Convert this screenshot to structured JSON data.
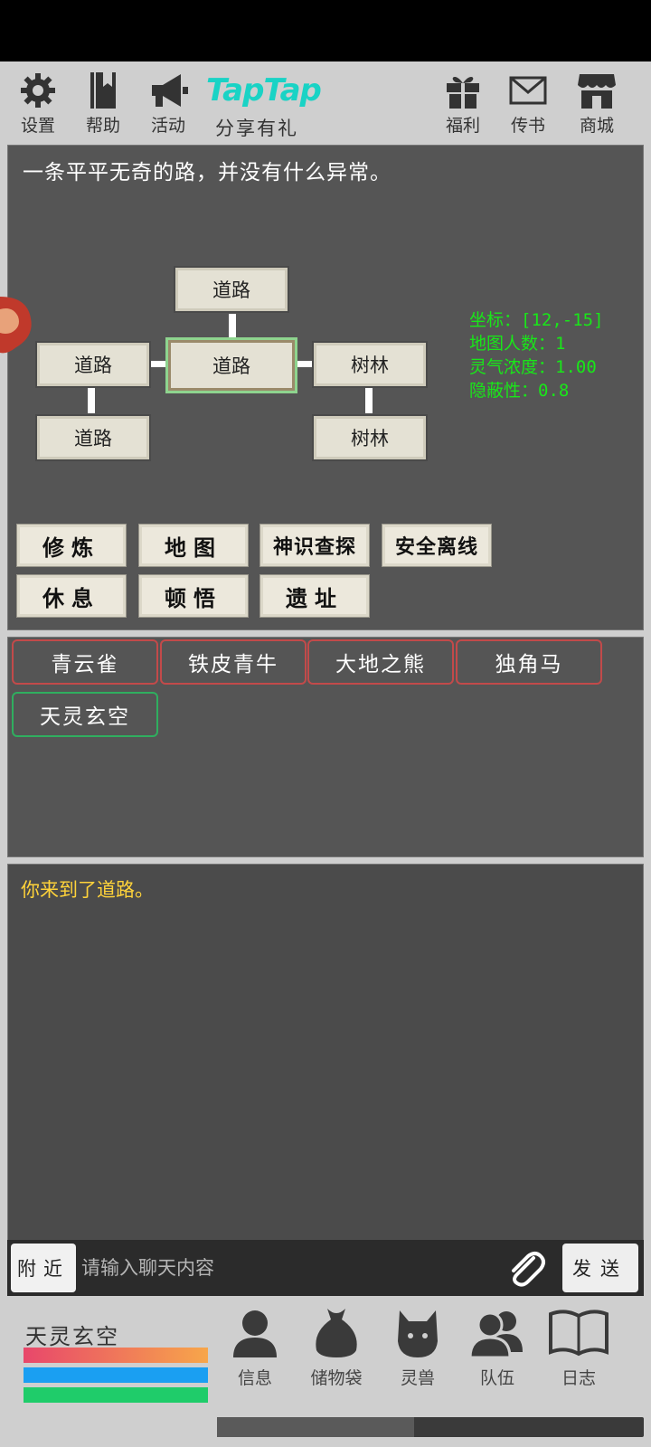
{
  "toolbar": {
    "settings_label": "设置",
    "help_label": "帮助",
    "activity_label": "活动",
    "taptap_logo": "TapTap",
    "share_label": "分享有礼",
    "welfare_label": "福利",
    "mail_label": "传书",
    "shop_label": "商城"
  },
  "map": {
    "description": "一条平平无奇的路，并没有什么异常。",
    "rooms": {
      "north": "道路",
      "west": "道路",
      "center": "道路",
      "east": "树林",
      "southwest": "道路",
      "southeast": "树林"
    },
    "stats": {
      "coords": "坐标：[12,-15]",
      "population": "地图人数：1",
      "spirit": "灵气浓度：1.00",
      "stealth": "隐蔽性：0.8"
    }
  },
  "actions": {
    "cultivate": "修炼",
    "map": "地图",
    "divine_sense": "神识查探",
    "safe_logout": "安全离线",
    "rest": "休息",
    "enlighten": "顿悟",
    "ruins": "遗址"
  },
  "beasts": [
    "青云雀",
    "铁皮青牛",
    "大地之熊",
    "独角马",
    "天灵玄空"
  ],
  "log": {
    "line1": "你来到了道路。"
  },
  "chat": {
    "channel_label": "附近",
    "placeholder": "请输入聊天内容",
    "send_label": "发送"
  },
  "player": {
    "name": "天灵玄空",
    "hp_color": "#e8476b",
    "mp_color": "#1a9ff2",
    "stamina_color": "#1fcc6a"
  },
  "nav": {
    "info_label": "信息",
    "bag_label": "储物袋",
    "beast_label": "灵兽",
    "team_label": "队伍",
    "log_label": "日志"
  },
  "colors": {
    "accent_taptap": "#19d3c5",
    "stat_green": "#19e619",
    "log_yellow": "#ffd33a",
    "beast_border_red": "#c24a4a",
    "beast_border_green": "#2fae5f"
  }
}
